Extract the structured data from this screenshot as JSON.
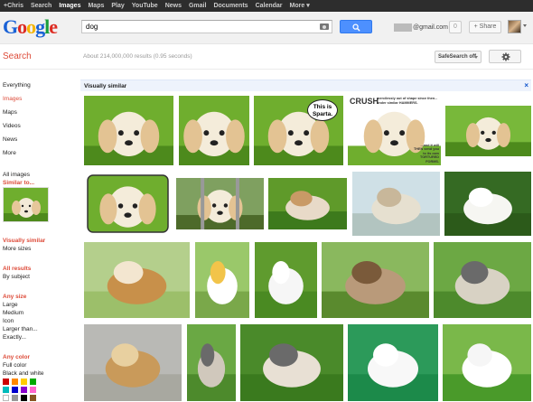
{
  "topbar": {
    "items": [
      {
        "label": "+Chris"
      },
      {
        "label": "Search"
      },
      {
        "label": "Images"
      },
      {
        "label": "Maps"
      },
      {
        "label": "Play"
      },
      {
        "label": "YouTube"
      },
      {
        "label": "News"
      },
      {
        "label": "Gmail"
      },
      {
        "label": "Documents"
      },
      {
        "label": "Calendar"
      },
      {
        "label": "More"
      }
    ],
    "active": "Images"
  },
  "logo": {
    "text": "Google",
    "colors": [
      "#1a62d6",
      "#dd2b22",
      "#f5b400",
      "#1a62d6",
      "#1a9e3c",
      "#dd2b22"
    ]
  },
  "search": {
    "value": "dog"
  },
  "account": {
    "email": "@gmail.com",
    "notifications": "0",
    "share_label": "+ Share"
  },
  "subheader": {
    "title": "Search",
    "stats": "About 214,000,000 results (0.95 seconds)",
    "safesearch": "SafeSearch off"
  },
  "sidebar": {
    "nav": [
      "Everything",
      "Images",
      "Maps",
      "Videos",
      "News",
      "More"
    ],
    "active_nav": "Images",
    "all_images": "All images",
    "similar_to": "Similar to...",
    "visually_similar": "Visually similar",
    "more_sizes": "More sizes",
    "all_results": "All results",
    "by_subject": "By subject",
    "any_size": "Any size",
    "sizes": [
      "Large",
      "Medium",
      "Icon",
      "Larger than...",
      "Exactly..."
    ],
    "any_color": "Any color",
    "colors_text": [
      "Full color",
      "Black and white"
    ],
    "swatches": [
      "#cc0000",
      "#ff8800",
      "#ffcc00",
      "#00aa00",
      "#00bbbb",
      "#0000cc",
      "#8800cc",
      "#ff66cc",
      "#ffffff",
      "#999999",
      "#000000",
      "#885522"
    ]
  },
  "results": {
    "header": "Visually similar",
    "close_label": "×",
    "captions": {
      "sparta": [
        "This is",
        "Sparta."
      ],
      "crush": "CRUSH",
      "crush_sub": "mercilessly out of shape since then... under similar HAMMERS.",
      "crush_sub2": "...and it will THEN send you to its own TORTURED FORMS."
    }
  }
}
